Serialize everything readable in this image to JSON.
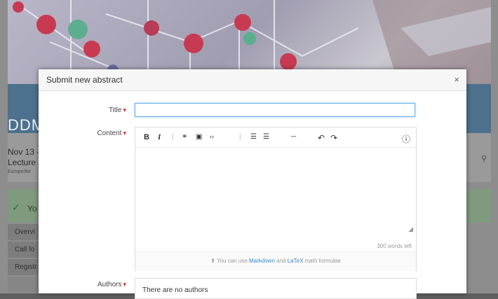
{
  "background": {
    "event_code": "DDM",
    "date": "Nov 13 -",
    "category": "Lecture",
    "location": "Europe/Be",
    "notice": "Yo",
    "menu": [
      "Overvi",
      "Call fo",
      "Registr",
      ""
    ]
  },
  "modal": {
    "title": "Submit new abstract",
    "close_glyph": "×",
    "fields": {
      "title": {
        "label": "Title",
        "value": "",
        "required_mark": "▾"
      },
      "content": {
        "label": "Content",
        "required_mark": "▾",
        "toolbar": {
          "bold": "B",
          "italic": "I",
          "sep1": "|",
          "link_icon": "🔗",
          "image_icon": "▣",
          "code_icon": "‹›",
          "sep2": "|",
          "ordered_list_icon": "☰",
          "unordered_list_icon": "☰",
          "hr_icon": "─",
          "undo_icon": "↶",
          "redo_icon": "↷",
          "help_icon": "ⓘ"
        },
        "words_left": "300 words left",
        "hint": {
          "icon": "⬆",
          "before": "You can use",
          "link1": "Markdown",
          "middle": "and",
          "link2": "LaTeX",
          "after": "math formulae"
        }
      },
      "authors": {
        "label": "Authors",
        "required_mark": "▾",
        "empty_text": "There are no authors"
      }
    }
  }
}
